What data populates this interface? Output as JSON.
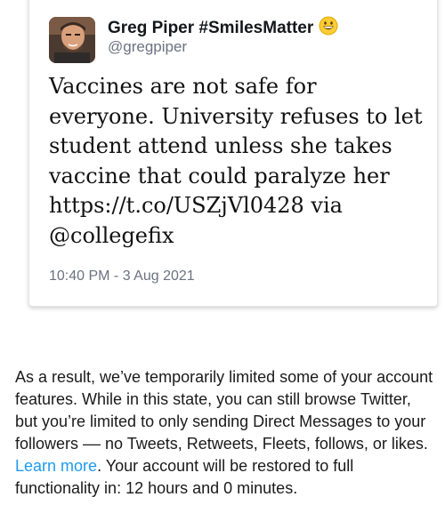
{
  "tweet": {
    "author_name": "Greg Piper #SmilesMatter",
    "author_emoji": "grinning-face-icon",
    "author_handle": "@gregpiper",
    "text": "Vaccines are not safe for everyone. University refuses to let student attend unless she takes vaccine that could paralyze her https://t.co/USZjVl0428 via @collegefix",
    "timestamp": "10:40 PM - 3 Aug 2021"
  },
  "notice": {
    "text_before_link": "As a result, we’ve temporarily limited some of your account features. While in this state, you can still browse Twitter, but you’re limited to only sending Direct Messages to your followers –– no Tweets, Retweets, Fleets, follows, or likes. ",
    "link_label": "Learn more",
    "text_after_link": ". Your account will be restored to full functionality in: 12 hours and 0 minutes."
  },
  "colors": {
    "link": "#1d9bf0",
    "secondary_text": "#6b7280"
  }
}
